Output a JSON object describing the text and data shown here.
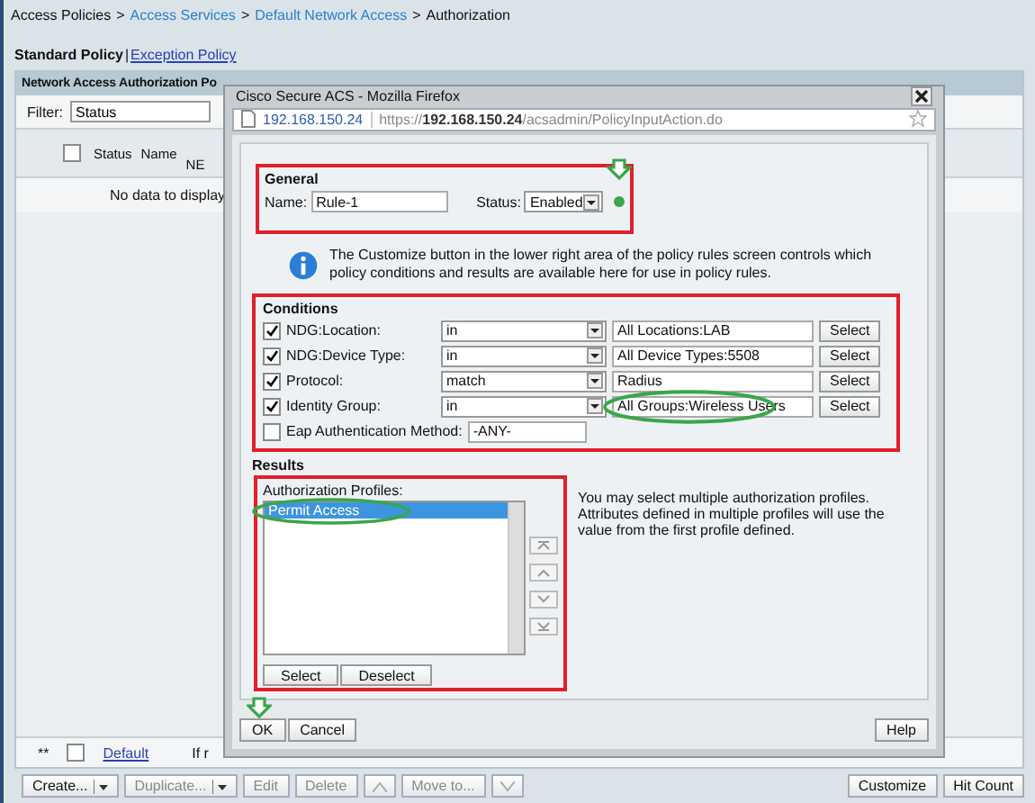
{
  "breadcrumb": [
    {
      "label": "Access Policies",
      "link": false,
      "separator": ">"
    },
    {
      "label": "Access Services",
      "link": true,
      "separator": ">"
    },
    {
      "label": "Default Network Access",
      "link": true,
      "separator": ">"
    },
    {
      "label": "Authorization",
      "link": false
    }
  ],
  "policy_tabs": [
    {
      "label": "Standard Policy",
      "selected": true,
      "divider": "|"
    },
    {
      "label": "Exception Policy",
      "selected": false
    }
  ],
  "panel": {
    "title": "Network Access Authorization Po",
    "filter_label": "Filter:",
    "filter_value": "Status",
    "select_all_checked": false,
    "columns": [
      "Status",
      "Name",
      "NE"
    ],
    "empty_text": "No data to display",
    "default_row": {
      "marker": "**",
      "checked": false,
      "name": "Default",
      "column_4": "If r"
    }
  },
  "toolbar": [
    {
      "kind": "text",
      "label": "Create...",
      "dropdown": true,
      "disabled": false
    },
    {
      "kind": "text",
      "label": "Duplicate...",
      "dropdown": true,
      "disabled": true
    },
    {
      "kind": "text",
      "label": "Edit",
      "dropdown": false,
      "disabled": true
    },
    {
      "kind": "text",
      "label": "Delete",
      "dropdown": false,
      "disabled": true
    },
    {
      "kind": "up",
      "disabled": true
    },
    {
      "kind": "text",
      "label": "Move to...",
      "dropdown": false,
      "disabled": true
    },
    {
      "kind": "down",
      "disabled": true
    }
  ],
  "toolbar_right": [
    "Customize",
    "Hit Count"
  ],
  "popup": {
    "title": "Cisco Secure ACS - Mozilla Firefox",
    "site": "192.168.150.24",
    "url": "https://**192.168.150.24**/acsadmin/PolicyInputAction.do",
    "general": {
      "heading": "General",
      "name_label": "Name:",
      "name_value": "Rule-1",
      "status_label": "Status:",
      "status_value": "Enabled",
      "status_ok": true
    },
    "info": "The Customize button in the lower right area of the policy rules screen controls which policy conditions and results are available here for use in policy rules.",
    "conditions": {
      "heading": "Conditions",
      "rows": [
        {
          "kind": "select",
          "checked": true,
          "label": "NDG:Location:",
          "operator": "in",
          "value": "All Locations:LAB",
          "button": "Select",
          "circled": false
        },
        {
          "kind": "select",
          "checked": true,
          "label": "NDG:Device Type:",
          "operator": "in",
          "value": "All Device Types:5508",
          "button": "Select",
          "circled": false
        },
        {
          "kind": "select",
          "checked": true,
          "label": "Protocol:",
          "operator": "match",
          "value": "Radius",
          "button": "Select",
          "circled": false
        },
        {
          "kind": "select",
          "checked": true,
          "label": "Identity Group:",
          "operator": "in",
          "value": "All Groups:Wireless Users",
          "button": "Select",
          "circled": true
        },
        {
          "kind": "plain",
          "checked": false,
          "label": "Eap Authentication Method:",
          "value": "-ANY-"
        }
      ]
    },
    "results": {
      "heading": "Results",
      "profiles_label": "Authorization Profiles:",
      "profiles": [
        {
          "label": "Permit Access",
          "selected": true
        }
      ],
      "buttons": [
        "Select",
        "Deselect"
      ],
      "note": "You may select multiple authorization profiles. Attributes defined in multiple profiles will use the value from the first profile defined."
    },
    "buttons": [
      "OK",
      "Cancel"
    ],
    "help": "Help"
  }
}
